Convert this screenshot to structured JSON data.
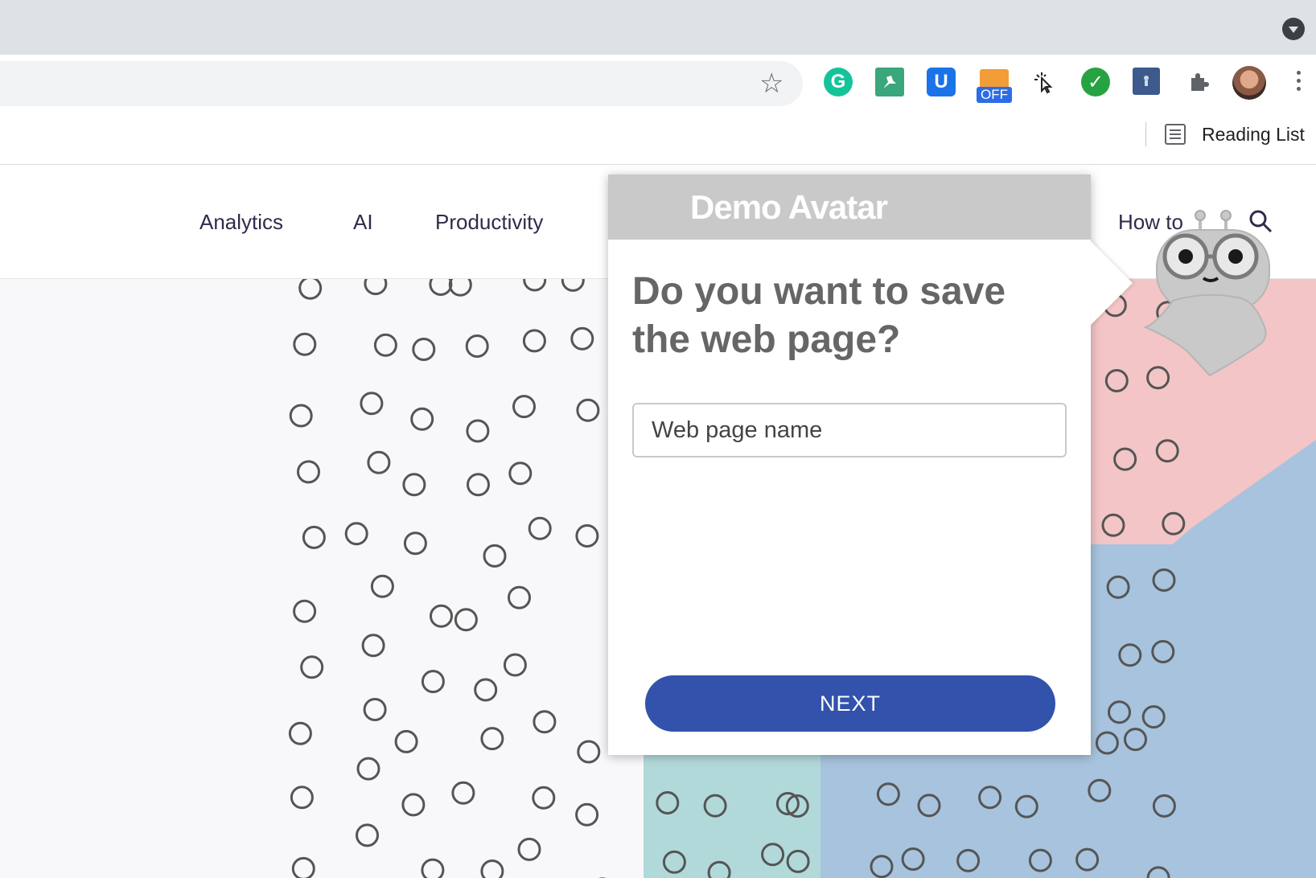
{
  "browser": {
    "extensions": {
      "grammarly_glyph": "G",
      "off_badge": "OFF",
      "u_glyph": "U"
    },
    "reading_list_label": "Reading List"
  },
  "site_nav": {
    "items": [
      "Analytics",
      "AI",
      "Productivity",
      "How to"
    ]
  },
  "popup": {
    "title": "Demo Avatar",
    "question": "Do you want to save the web page?",
    "input_placeholder": "Web page name",
    "next_label": "NEXT"
  },
  "colors": {
    "popup_header": "#c9c9c9",
    "next_button": "#3252ac",
    "hero_pink": "#f3c5c7",
    "hero_blue": "#a7c3dd"
  }
}
